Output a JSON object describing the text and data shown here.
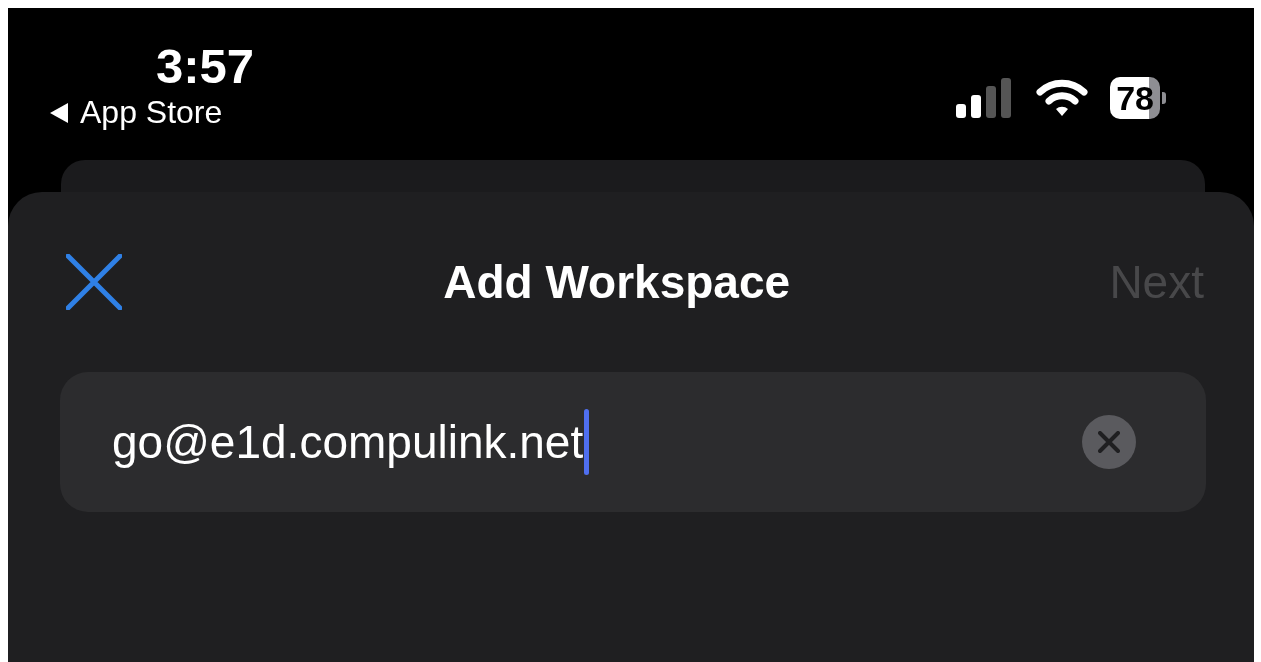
{
  "status_bar": {
    "time": "3:57",
    "back_label": "App Store",
    "battery": "78"
  },
  "sheet": {
    "title": "Add Workspace",
    "next": {
      "label": "Next",
      "disabled": true
    }
  },
  "field": {
    "value": "go@e1d.compulink.net",
    "focused": true
  }
}
